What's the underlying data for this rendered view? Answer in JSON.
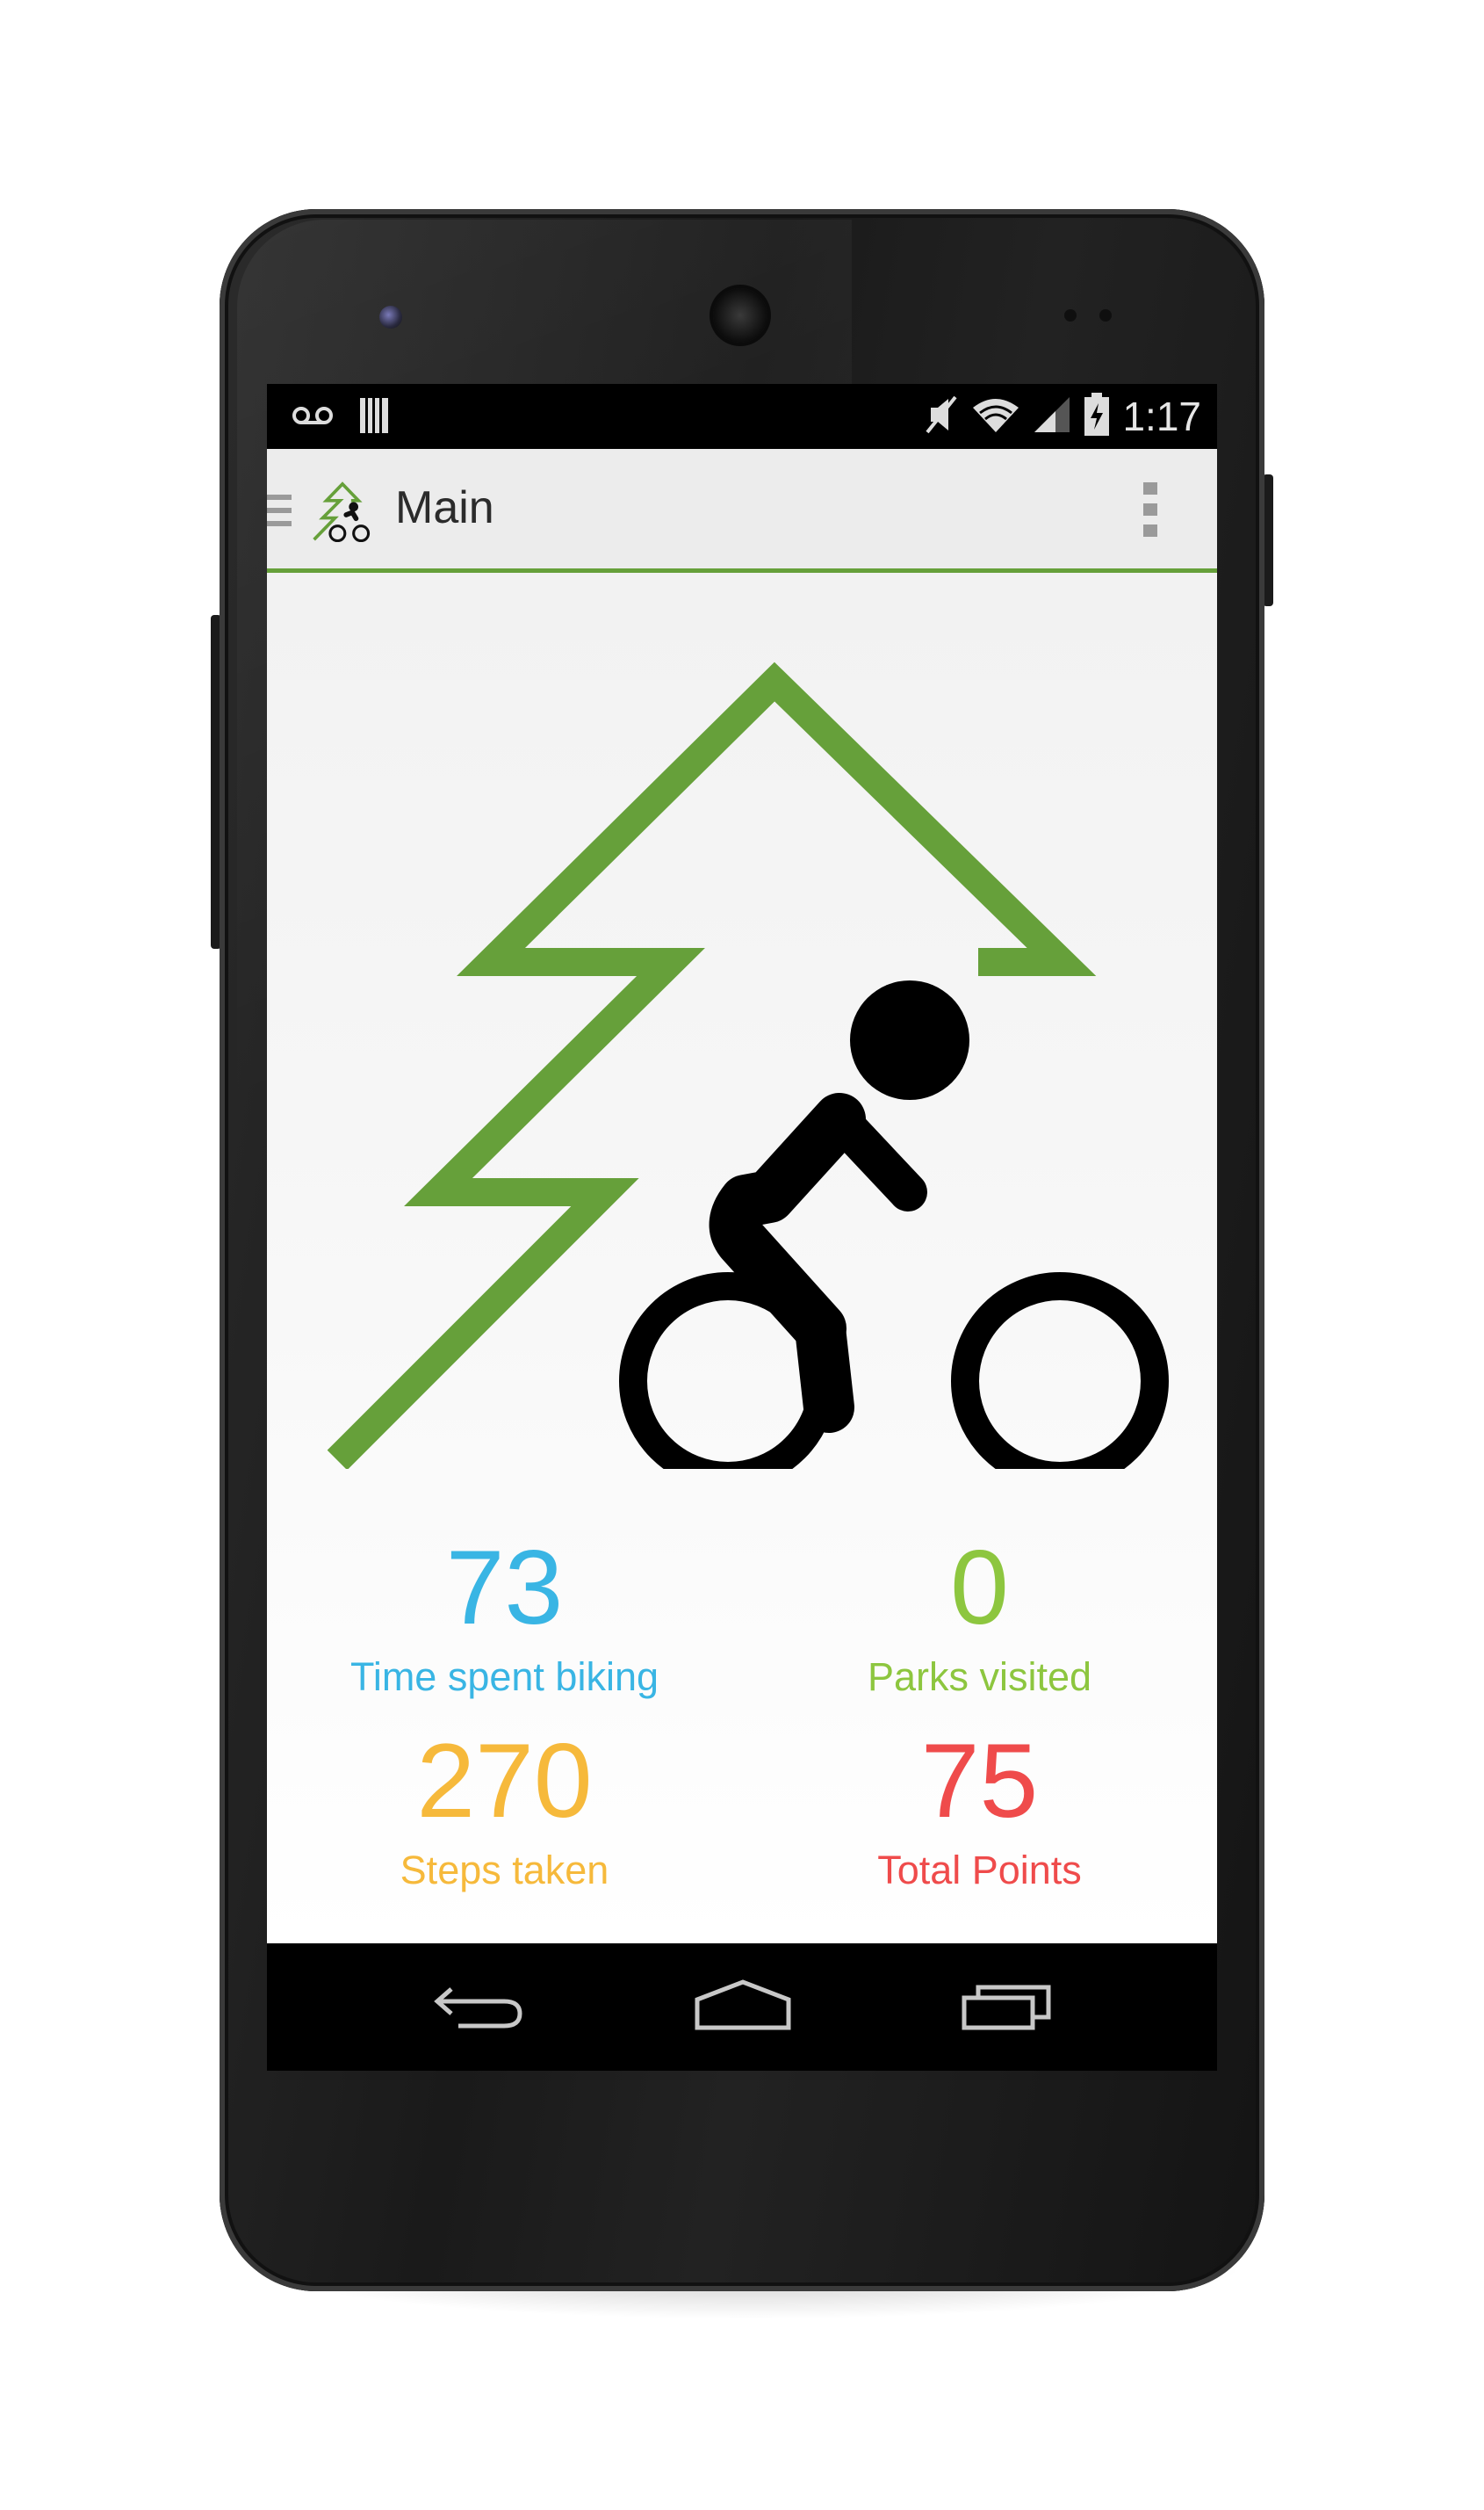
{
  "status_bar": {
    "time": "1:17",
    "icons": [
      "voicemail-icon",
      "storage-icon",
      "mute-icon",
      "wifi-icon",
      "cell-signal-icon",
      "battery-charging-icon"
    ]
  },
  "action_bar": {
    "title": "Main",
    "icons": [
      "drawer-icon",
      "app-logo-icon",
      "overflow-menu-icon"
    ]
  },
  "colors": {
    "accent_green": "#66a03a",
    "time_color": "#39b5e4",
    "parks_color": "#8dc63f",
    "steps_color": "#f6b93b",
    "points_color": "#ef4b4b"
  },
  "stats": [
    {
      "value": "73",
      "label": "Time spent biking"
    },
    {
      "value": "0",
      "label": "Parks visited"
    },
    {
      "value": "270",
      "label": "Steps taken"
    },
    {
      "value": "75",
      "label": "Total Points"
    }
  ],
  "nav_bar": {
    "icons": [
      "back-icon",
      "home-icon",
      "recents-icon"
    ]
  }
}
